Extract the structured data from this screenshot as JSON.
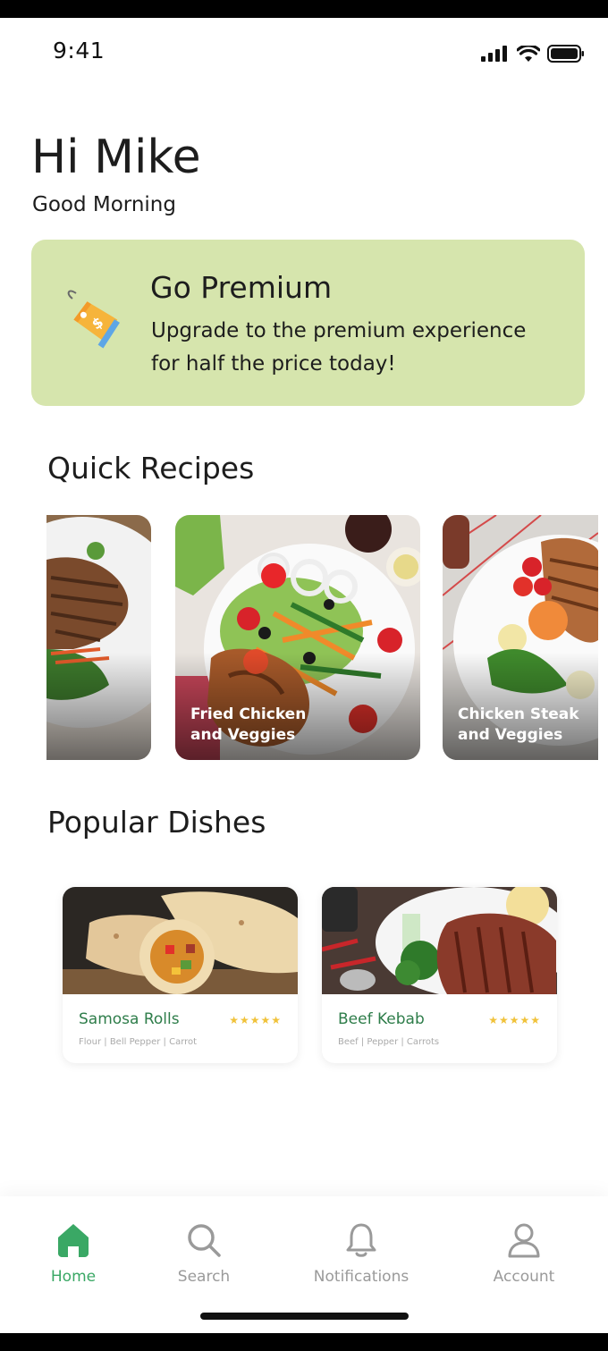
{
  "status": {
    "time": "9:41"
  },
  "header": {
    "title": "Hi Mike",
    "subtitle": "Good Morning"
  },
  "premium": {
    "title": "Go Premium",
    "line1": "Upgrade to the premium experience",
    "line2": "for half the price today!",
    "icon": "price-tag-icon"
  },
  "quick_recipes": {
    "title": "Quick Recipes",
    "items": [
      {
        "label_line1": "",
        "label_line2": ""
      },
      {
        "label_line1": "Fried Chicken",
        "label_line2": "and Veggies"
      },
      {
        "label_line1": "Chicken Steak",
        "label_line2": "and Veggies"
      }
    ]
  },
  "popular_dishes": {
    "title": "Popular Dishes",
    "items": [
      {
        "name": "Samosa Rolls",
        "rating": "★★★★★",
        "ingredients": "Flour  |  Bell Pepper  |  Carrot"
      },
      {
        "name": "Beef Kebab",
        "rating": "★★★★★",
        "ingredients": "Beef  |  Pepper  |  Carrots"
      }
    ]
  },
  "nav": {
    "items": [
      {
        "label": "Home",
        "icon": "home-icon",
        "active": true
      },
      {
        "label": "Search",
        "icon": "search-icon"
      },
      {
        "label": "Notifications",
        "icon": "bell-icon"
      },
      {
        "label": "Account",
        "icon": "user-icon"
      }
    ]
  },
  "colors": {
    "accent": "#3aa865",
    "premium_bg": "#d6e5ad",
    "star": "#f0c23a",
    "dish_name": "#2e7d4a"
  }
}
